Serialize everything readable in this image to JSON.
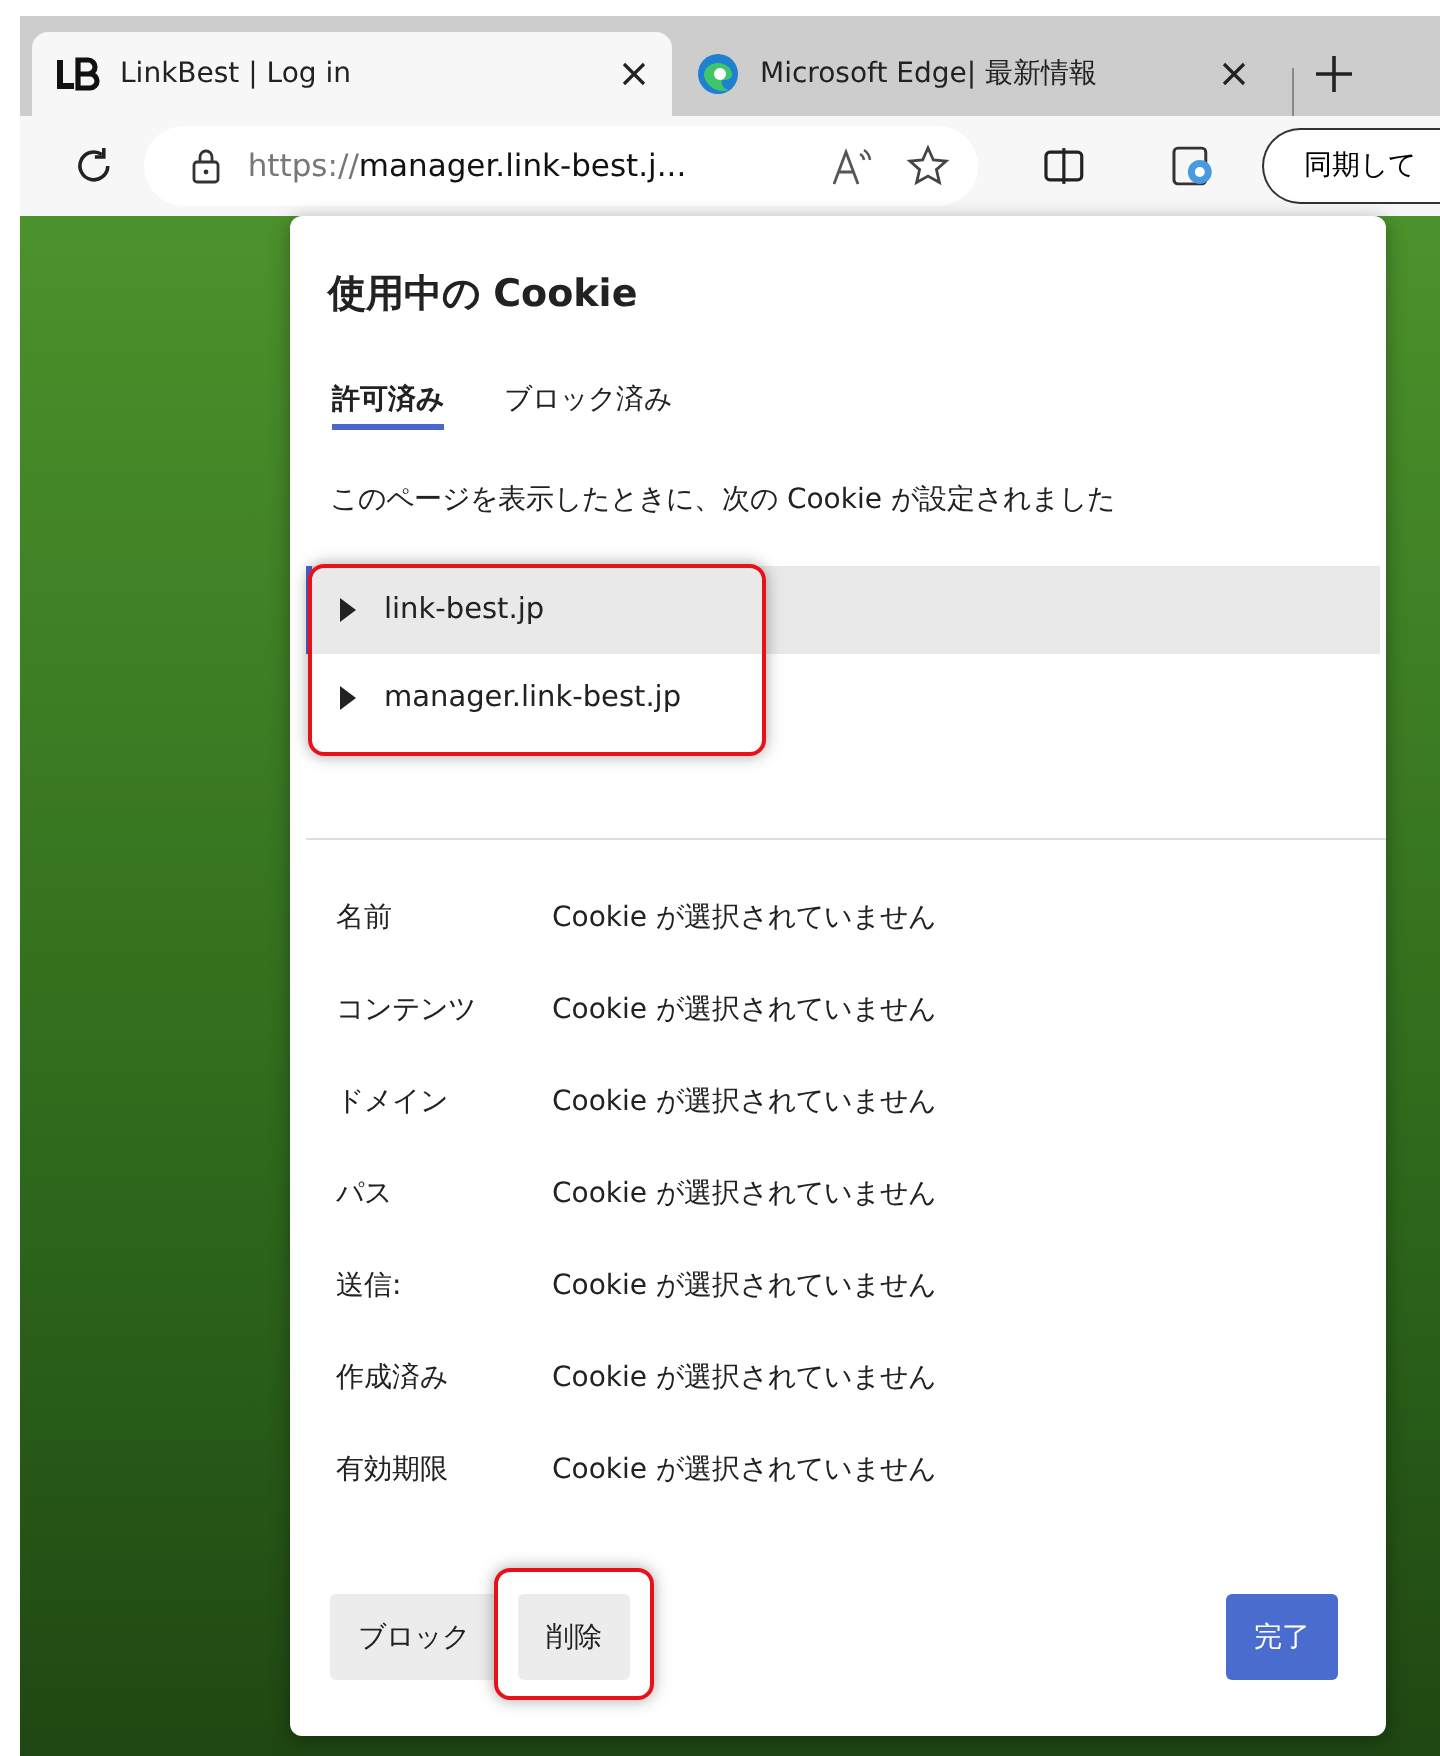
{
  "browser": {
    "tabs": [
      {
        "title": "LinkBest | Log in",
        "selected": true,
        "kind": "site"
      },
      {
        "title": "Microsoft Edge| 最新情報",
        "selected": false,
        "kind": "edge"
      }
    ],
    "address": {
      "scheme": "https://",
      "host": "manager.link-best.j..."
    },
    "sync_button": "同期して"
  },
  "dialog": {
    "title": "使用中の Cookie",
    "tabs": [
      {
        "label": "許可済み",
        "selected": true
      },
      {
        "label": "ブロック済み",
        "selected": false
      }
    ],
    "description": "このページを表示したときに、次の Cookie が設定されました",
    "cookies_highlighted": true,
    "cookies": [
      {
        "domain": "link-best.jp",
        "selected": true,
        "expanded": false
      },
      {
        "domain": "manager.link-best.jp",
        "selected": false,
        "expanded": false
      }
    ],
    "details": [
      {
        "label": "名前",
        "value": "Cookie が選択されていません"
      },
      {
        "label": "コンテンツ",
        "value": "Cookie が選択されていません"
      },
      {
        "label": "ドメイン",
        "value": "Cookie が選択されていません"
      },
      {
        "label": "パス",
        "value": "Cookie が選択されていません"
      },
      {
        "label": "送信:",
        "value": "Cookie が選択されていません"
      },
      {
        "label": "作成済み",
        "value": "Cookie が選択されていません"
      },
      {
        "label": "有効期限",
        "value": "Cookie が選択されていません"
      }
    ],
    "buttons": [
      {
        "label": "ブロック",
        "kind": "secondary",
        "highlighted": false
      },
      {
        "label": "削除",
        "kind": "secondary",
        "highlighted": true
      },
      {
        "label": "完了",
        "kind": "primary",
        "highlighted": false
      }
    ]
  }
}
